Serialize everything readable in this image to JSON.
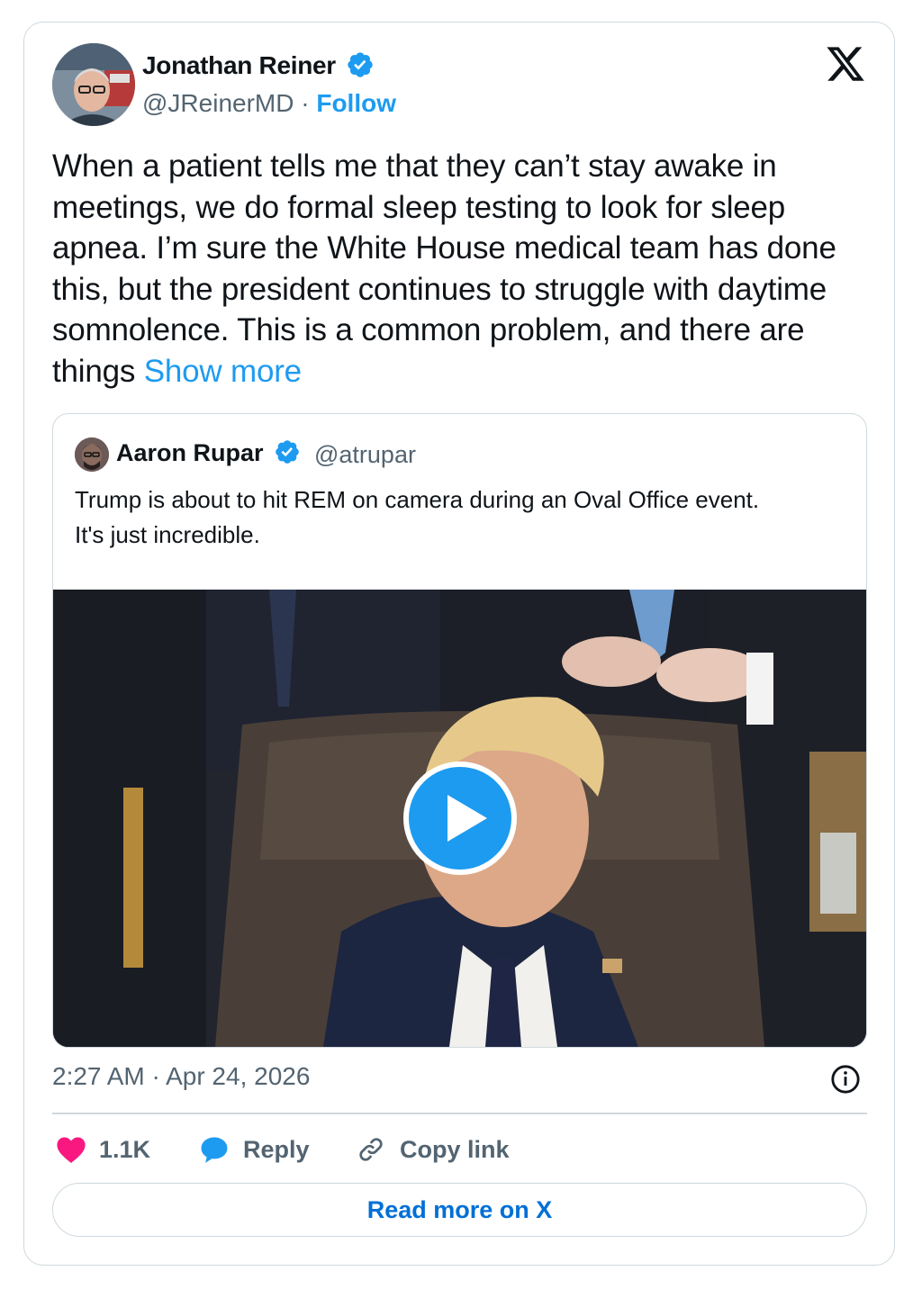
{
  "author": {
    "name": "Jonathan Reiner",
    "handle": "@JReinerMD",
    "separator": " · ",
    "follow_label": "Follow"
  },
  "tweet": {
    "text": "When a patient tells me that they can’t stay awake in meetings, we do formal sleep testing to look for sleep apnea. I’m sure the White House medical team has done this, but the president continues to struggle with daytime somnolence. This is a common problem, and there are things ",
    "show_more": "Show more"
  },
  "quoted_tweet": {
    "name": "Aaron Rupar",
    "handle": "@atrupar",
    "text_line1": "Trump is about to hit REM on camera during an Oval Office event.",
    "text_line2": "It's just incredible."
  },
  "timestamp": "2:27 AM · Apr 24, 2026",
  "actions": {
    "like_count": "1.1K",
    "reply_label": "Reply",
    "copy_label": "Copy link"
  },
  "read_more_label": "Read more on X",
  "icons": {
    "verified": "verified-badge-icon",
    "x_logo": "x-logo-icon",
    "play": "play-icon",
    "info": "info-icon",
    "like": "heart-icon",
    "reply": "reply-bubble-icon",
    "copy": "link-icon"
  },
  "colors": {
    "accent": "#1d9bf0",
    "link": "#006fd6",
    "like": "#f91880",
    "muted": "#536471",
    "border": "#cfd9de"
  }
}
